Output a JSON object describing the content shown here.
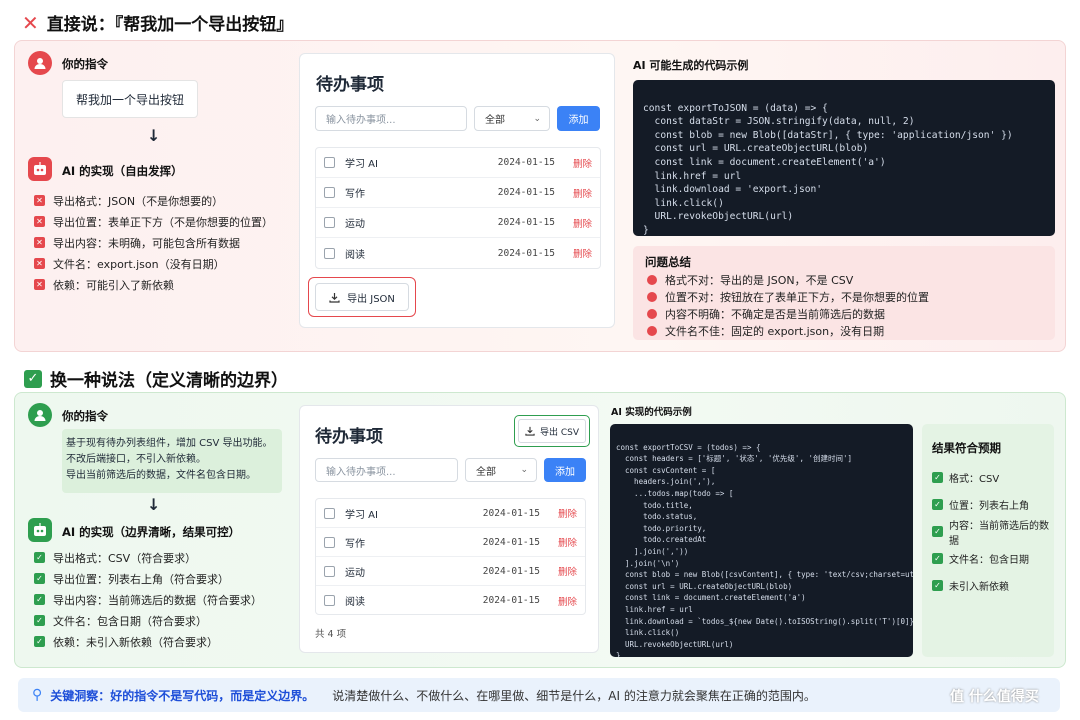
{
  "section1": {
    "title": "直接说：『帮我加一个导出按钮』",
    "instruction_label": "你的指令",
    "instruction_text": "帮我加一个导出按钮",
    "impl_label": "AI 的实现（自由发挥）",
    "impl_items": [
      "导出格式：JSON（不是你想要的）",
      "导出位置：表单正下方（不是你想要的位置）",
      "导出内容：未明确，可能包含所有数据",
      "文件名：export.json（没有日期）",
      "依赖：可能引入了新依赖"
    ],
    "todo": {
      "title": "待办事项",
      "input_placeholder": "输入待办事项...",
      "filter": "全部",
      "add": "添加",
      "items": [
        {
          "name": "学习 AI",
          "date": "2024-01-15",
          "del": "删除"
        },
        {
          "name": "写作",
          "date": "2024-01-15",
          "del": "删除"
        },
        {
          "name": "运动",
          "date": "2024-01-15",
          "del": "删除"
        },
        {
          "name": "阅读",
          "date": "2024-01-15",
          "del": "删除"
        }
      ],
      "export": "导出 JSON"
    },
    "code_title": "AI 可能生成的代码示例",
    "code_lines": [
      "const exportToJSON = (data) => {",
      "  const dataStr = JSON.stringify(data, null, 2)",
      "  const blob = new Blob([dataStr], { type: 'application/json' })",
      "  const url = URL.createObjectURL(blob)",
      "  const link = document.createElement('a')",
      "  link.href = url",
      "  link.download = 'export.json'",
      "  link.click()",
      "  URL.revokeObjectURL(url)",
      "}"
    ],
    "problem_title": "问题总结",
    "problems": [
      "格式不对：导出的是 JSON，不是 CSV",
      "位置不对：按钮放在了表单正下方，不是你想要的位置",
      "内容不明确：不确定是否是当前筛选后的数据",
      "文件名不佳：固定的 export.json，没有日期"
    ]
  },
  "section2": {
    "title": "换一种说法（定义清晰的边界）",
    "instruction_label": "你的指令",
    "instruction_lines": [
      "基于现有待办列表组件，增加 CSV 导出功能。",
      "不改后端接口，不引入新依赖。",
      "导出当前筛选后的数据，文件名包含日期。"
    ],
    "impl_label": "AI 的实现（边界清晰，结果可控）",
    "impl_items": [
      "导出格式：CSV（符合要求）",
      "导出位置：列表右上角（符合要求）",
      "导出内容：当前筛选后的数据（符合要求）",
      "文件名：包含日期（符合要求）",
      "依赖：未引入新依赖（符合要求）"
    ],
    "todo": {
      "title": "待办事项",
      "export": "导出 CSV",
      "input_placeholder": "输入待办事项...",
      "filter": "全部",
      "add": "添加",
      "items": [
        {
          "name": "学习 AI",
          "date": "2024-01-15",
          "del": "删除"
        },
        {
          "name": "写作",
          "date": "2024-01-15",
          "del": "删除"
        },
        {
          "name": "运动",
          "date": "2024-01-15",
          "del": "删除"
        },
        {
          "name": "阅读",
          "date": "2024-01-15",
          "del": "删除"
        }
      ],
      "count": "共 4 项"
    },
    "code_title": "AI 实现的代码示例",
    "code_lines": [
      "const exportToCSV = (todos) => {",
      "  const headers = ['标题', '状态', '优先级', '创建时间']",
      "  const csvContent = [",
      "    headers.join(','),",
      "    ...todos.map(todo => [",
      "      todo.title,",
      "      todo.status,",
      "      todo.priority,",
      "      todo.createdAt",
      "    ].join(','))",
      "  ].join('\\n')",
      "  const blob = new Blob([csvContent], { type: 'text/csv;charset=utf-8;'})",
      "  const url = URL.createObjectURL(blob)",
      "  const link = document.createElement('a')",
      "  link.href = url",
      "  link.download = `todos_${new Date().toISOString().split('T')[0]}.csv`",
      "  link.click()",
      "  URL.revokeObjectURL(url)",
      "}"
    ],
    "result_title": "结果符合预期",
    "results": [
      "格式：CSV",
      "位置：列表右上角",
      "内容：当前筛选后的数据",
      "文件名：包含日期",
      "未引入新依赖"
    ]
  },
  "footer": {
    "key": "关键洞察：好的指令不是写代码，而是定义边界。",
    "text": "说清楚做什么、不做什么、在哪里做、细节是什么，AI 的注意力就会聚焦在正确的范围内。",
    "watermark": "值 什么值得买"
  },
  "colors": {
    "red": "#e5484d",
    "green": "#2e9e4f",
    "blue": "#3b82f6"
  }
}
